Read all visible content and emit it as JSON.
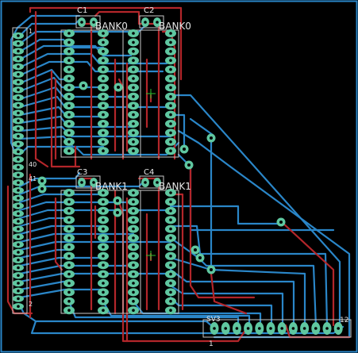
{
  "colors": {
    "background": "#000000",
    "bottom_trace": "#2a86c8",
    "top_trace": "#b3262a",
    "pad_fill": "#5fc7a0",
    "pad_hole": "#000000",
    "outline": "#c8c8c8",
    "text": "#e6e6e6",
    "origin_cross": "#2ec22e"
  },
  "labels": {
    "c1": "C1",
    "c2": "C2",
    "c3": "C3",
    "c4": "C4",
    "bank0_left": "BANK0",
    "bank0_right": "BANK0",
    "bank1_left": "BANK1",
    "bank1_right": "BANK1",
    "sv3": "SV3",
    "connector_first_pin": "1",
    "connector_last_pin": "12",
    "left_header_top": "1",
    "left_header_mid": "40",
    "left_header_mid2": "41",
    "left_header_bottom": "2"
  }
}
